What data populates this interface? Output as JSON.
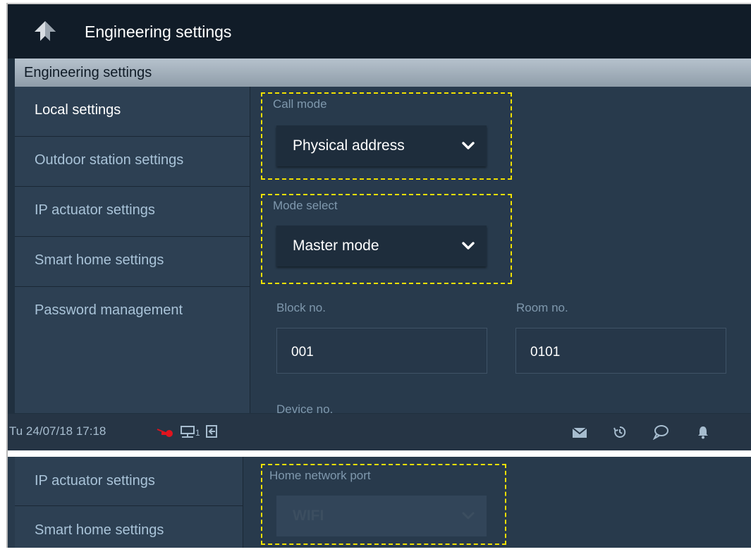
{
  "header": {
    "title": "Engineering settings"
  },
  "section": {
    "title": "Engineering settings"
  },
  "sidebar": {
    "items": [
      {
        "label": "Local settings",
        "active": true
      },
      {
        "label": "Outdoor station settings"
      },
      {
        "label": "IP actuator settings"
      },
      {
        "label": "Smart home settings"
      },
      {
        "label": "Password management"
      }
    ]
  },
  "form": {
    "call_mode": {
      "label": "Call mode",
      "value": "Physical address"
    },
    "mode_select": {
      "label": "Mode select",
      "value": "Master mode"
    },
    "block_no": {
      "label": "Block no.",
      "value": "001"
    },
    "room_no": {
      "label": "Room no.",
      "value": "0101"
    },
    "device_no": {
      "label": "Device no."
    }
  },
  "statusbar": {
    "datetime": "Tu 24/07/18  17:18",
    "network_index": "1",
    "icons": [
      "camera-off-icon",
      "network-icon",
      "logout-icon",
      "mail-icon",
      "history-icon",
      "message-icon",
      "bell-icon"
    ]
  },
  "panel2": {
    "sidebar_items": [
      {
        "label": "IP actuator settings"
      },
      {
        "label": "Smart home settings"
      }
    ],
    "home_network_port": {
      "label": "Home network port",
      "value": "WIFI",
      "disabled": true
    }
  },
  "colors": {
    "background": "#20303f",
    "titlebar": "#111c28",
    "highlight_dash": "#f0e000",
    "status_red": "#e0141e"
  }
}
